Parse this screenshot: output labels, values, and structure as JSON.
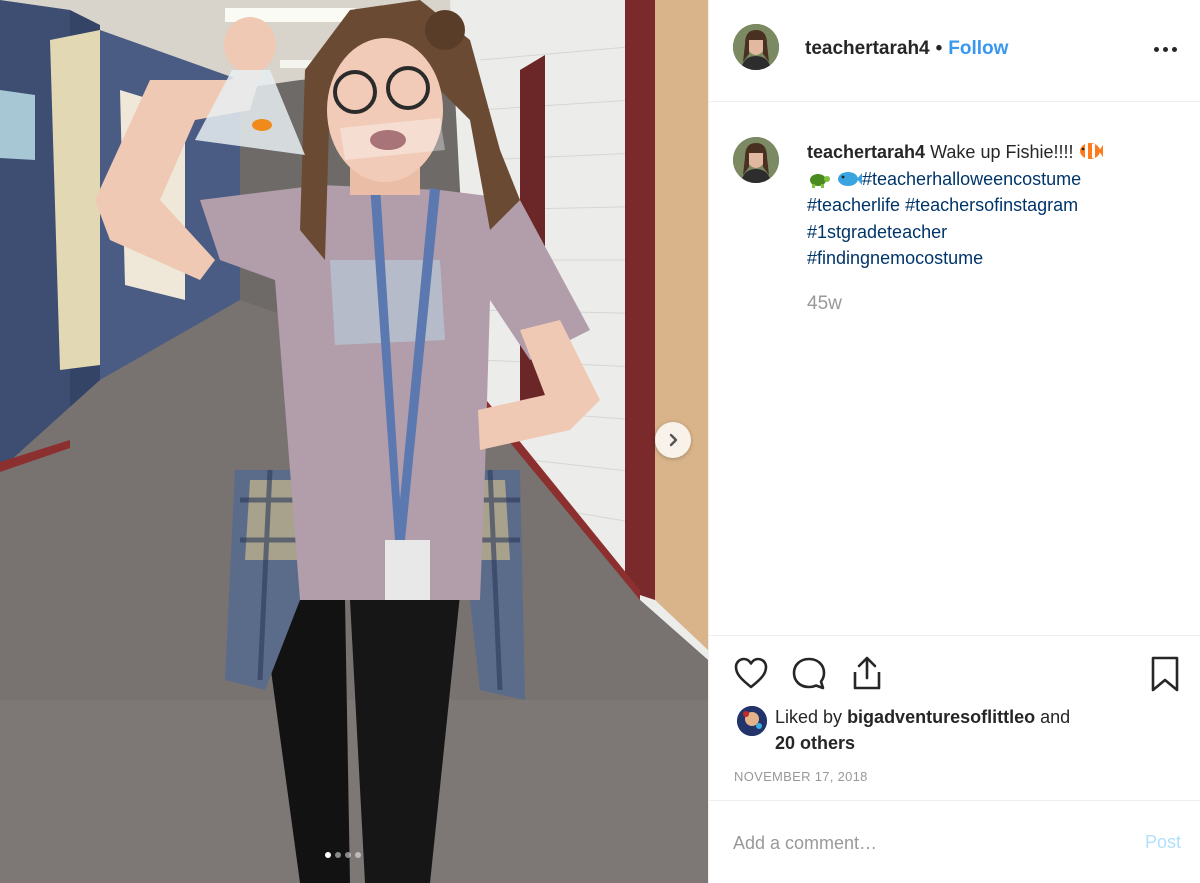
{
  "post": {
    "username": "teachertarah4",
    "separator": "•",
    "follow_label": "Follow",
    "more_icon": "more-options-icon"
  },
  "caption": {
    "username": "teachertarah4",
    "text": "Wake up Fishie!!!!",
    "hashtags": [
      "#teacherhalloweencostume",
      "#teacherlife",
      "#teachersofinstagram",
      "#1stgradeteacher",
      "#findingnemocostume"
    ],
    "emojis": [
      "clownfish-emoji",
      "turtle-emoji",
      "blue-fish-emoji"
    ],
    "time_ago": "45w"
  },
  "actions": {
    "icons": [
      "heart-icon",
      "comment-icon",
      "share-icon",
      "bookmark-icon"
    ]
  },
  "likes": {
    "prefix": "Liked by",
    "liker": "bigadventuresoflittleo",
    "joiner": "and",
    "others": "20 others"
  },
  "date": "NOVEMBER 17, 2018",
  "comment": {
    "placeholder": "Add a comment…",
    "post_label": "Post"
  },
  "carousel": {
    "total": 4,
    "current": 1
  },
  "colors": {
    "link": "#3897f0",
    "hashtag": "#003569",
    "muted": "#999999",
    "post_disabled": "#b2dffc"
  }
}
